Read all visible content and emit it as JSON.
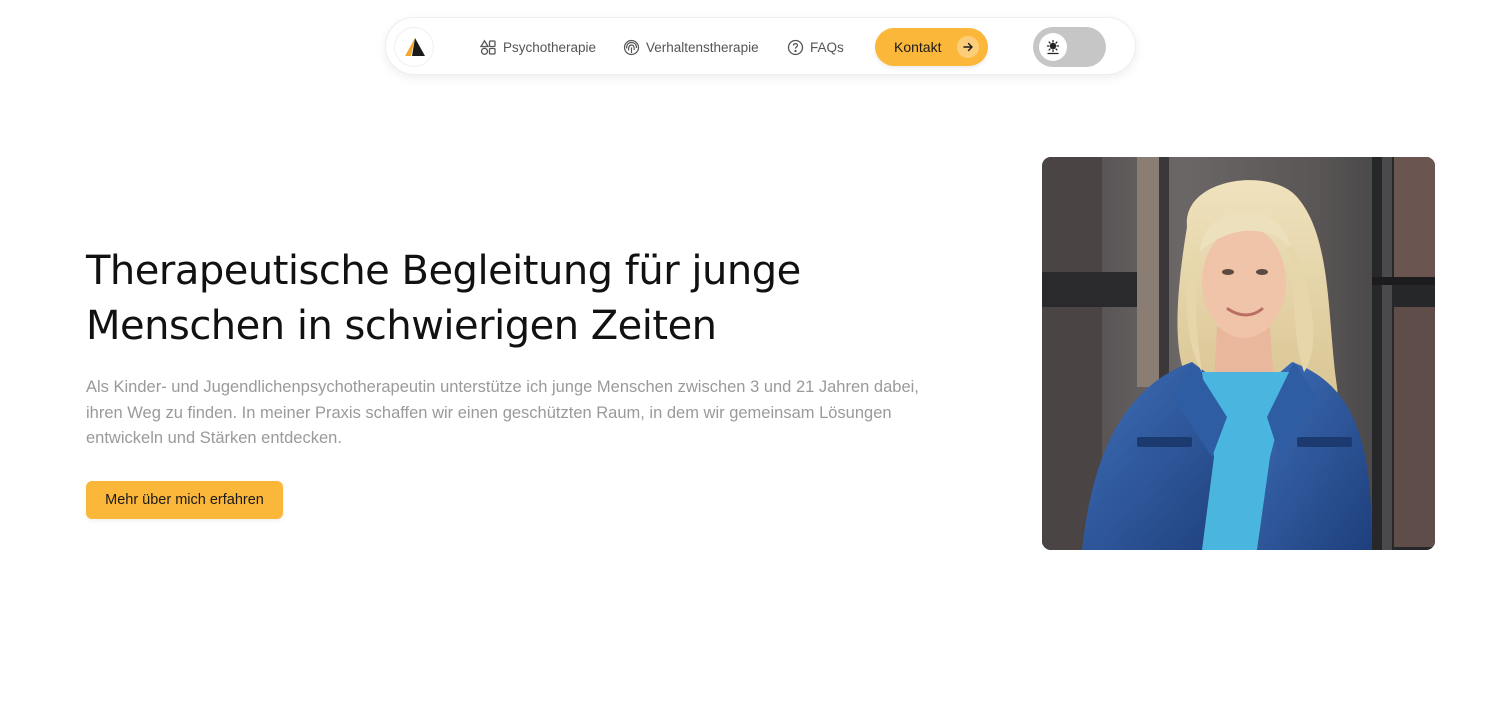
{
  "nav": {
    "logo_icon": "tent-logo-icon",
    "links": [
      {
        "label": "Psychotherapie",
        "icon": "shapes-icon"
      },
      {
        "label": "Verhaltenstherapie",
        "icon": "fingerprint-icon"
      },
      {
        "label": "FAQs",
        "icon": "question-circle-icon"
      }
    ],
    "contact": {
      "label": "Kontakt",
      "icon": "arrow-right-icon"
    },
    "theme_toggle": {
      "icon": "sun-icon",
      "state": "light"
    }
  },
  "hero": {
    "title_line1": "Therapeutische Begleitung für junge",
    "title_line2": "Menschen in schwierigen Zeiten",
    "description": "Als Kinder- und Jugendlichenpsychotherapeutin unterstütze ich junge Menschen zwischen 3 und 21 Jahren dabei, ihren Weg zu finden. In meiner Praxis schaffen wir einen geschützten Raum, in dem wir gemeinsam Lösungen entwickeln und Stärken entdecken.",
    "cta_label": "Mehr über mich erfahren"
  },
  "colors": {
    "accent": "#fbb73a",
    "text_dark": "#111111",
    "text_muted": "#9a9a9a",
    "toggle_bg": "#c6c6c6"
  }
}
